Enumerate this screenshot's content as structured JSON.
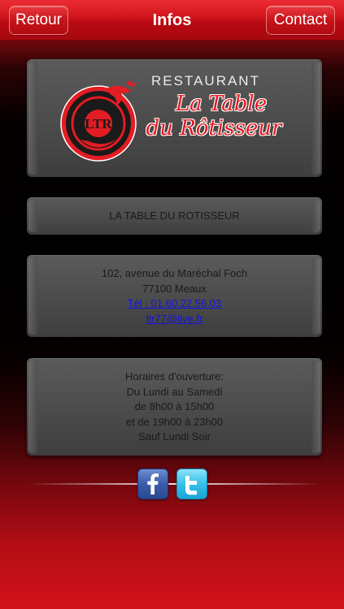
{
  "navbar": {
    "back_label": "Retour",
    "title": "Infos",
    "contact_label": "Contact"
  },
  "logo": {
    "restaurant_word": "RESTAURANT",
    "script_line1": "La Table",
    "script_line2": "du Rôtisseur",
    "emblem_letters": "LTR"
  },
  "name_panel": {
    "name": "LA TABLE DU ROTISSEUR"
  },
  "address_panel": {
    "street": "102, avenue du Maréchal Foch",
    "city": "77100 Meaux",
    "phone": "Tél : 01.60.22.56.03",
    "email": "ltr77@live.fr"
  },
  "hours_panel": {
    "heading": "Horaires d'ouverture:",
    "days": "Du Lundi au Samedi",
    "morning": "de 8h00 à 15h00",
    "evening": "et de 19h00 à 23h00",
    "exception": "Sauf Lundi Soir"
  },
  "social": {
    "facebook_icon": "facebook-icon",
    "twitter_icon": "twitter-icon"
  },
  "colors": {
    "brand_red": "#d0141b",
    "panel_gray": "#4a4a4a",
    "link_blue": "#1313e0",
    "logo_red": "#e41c23"
  }
}
